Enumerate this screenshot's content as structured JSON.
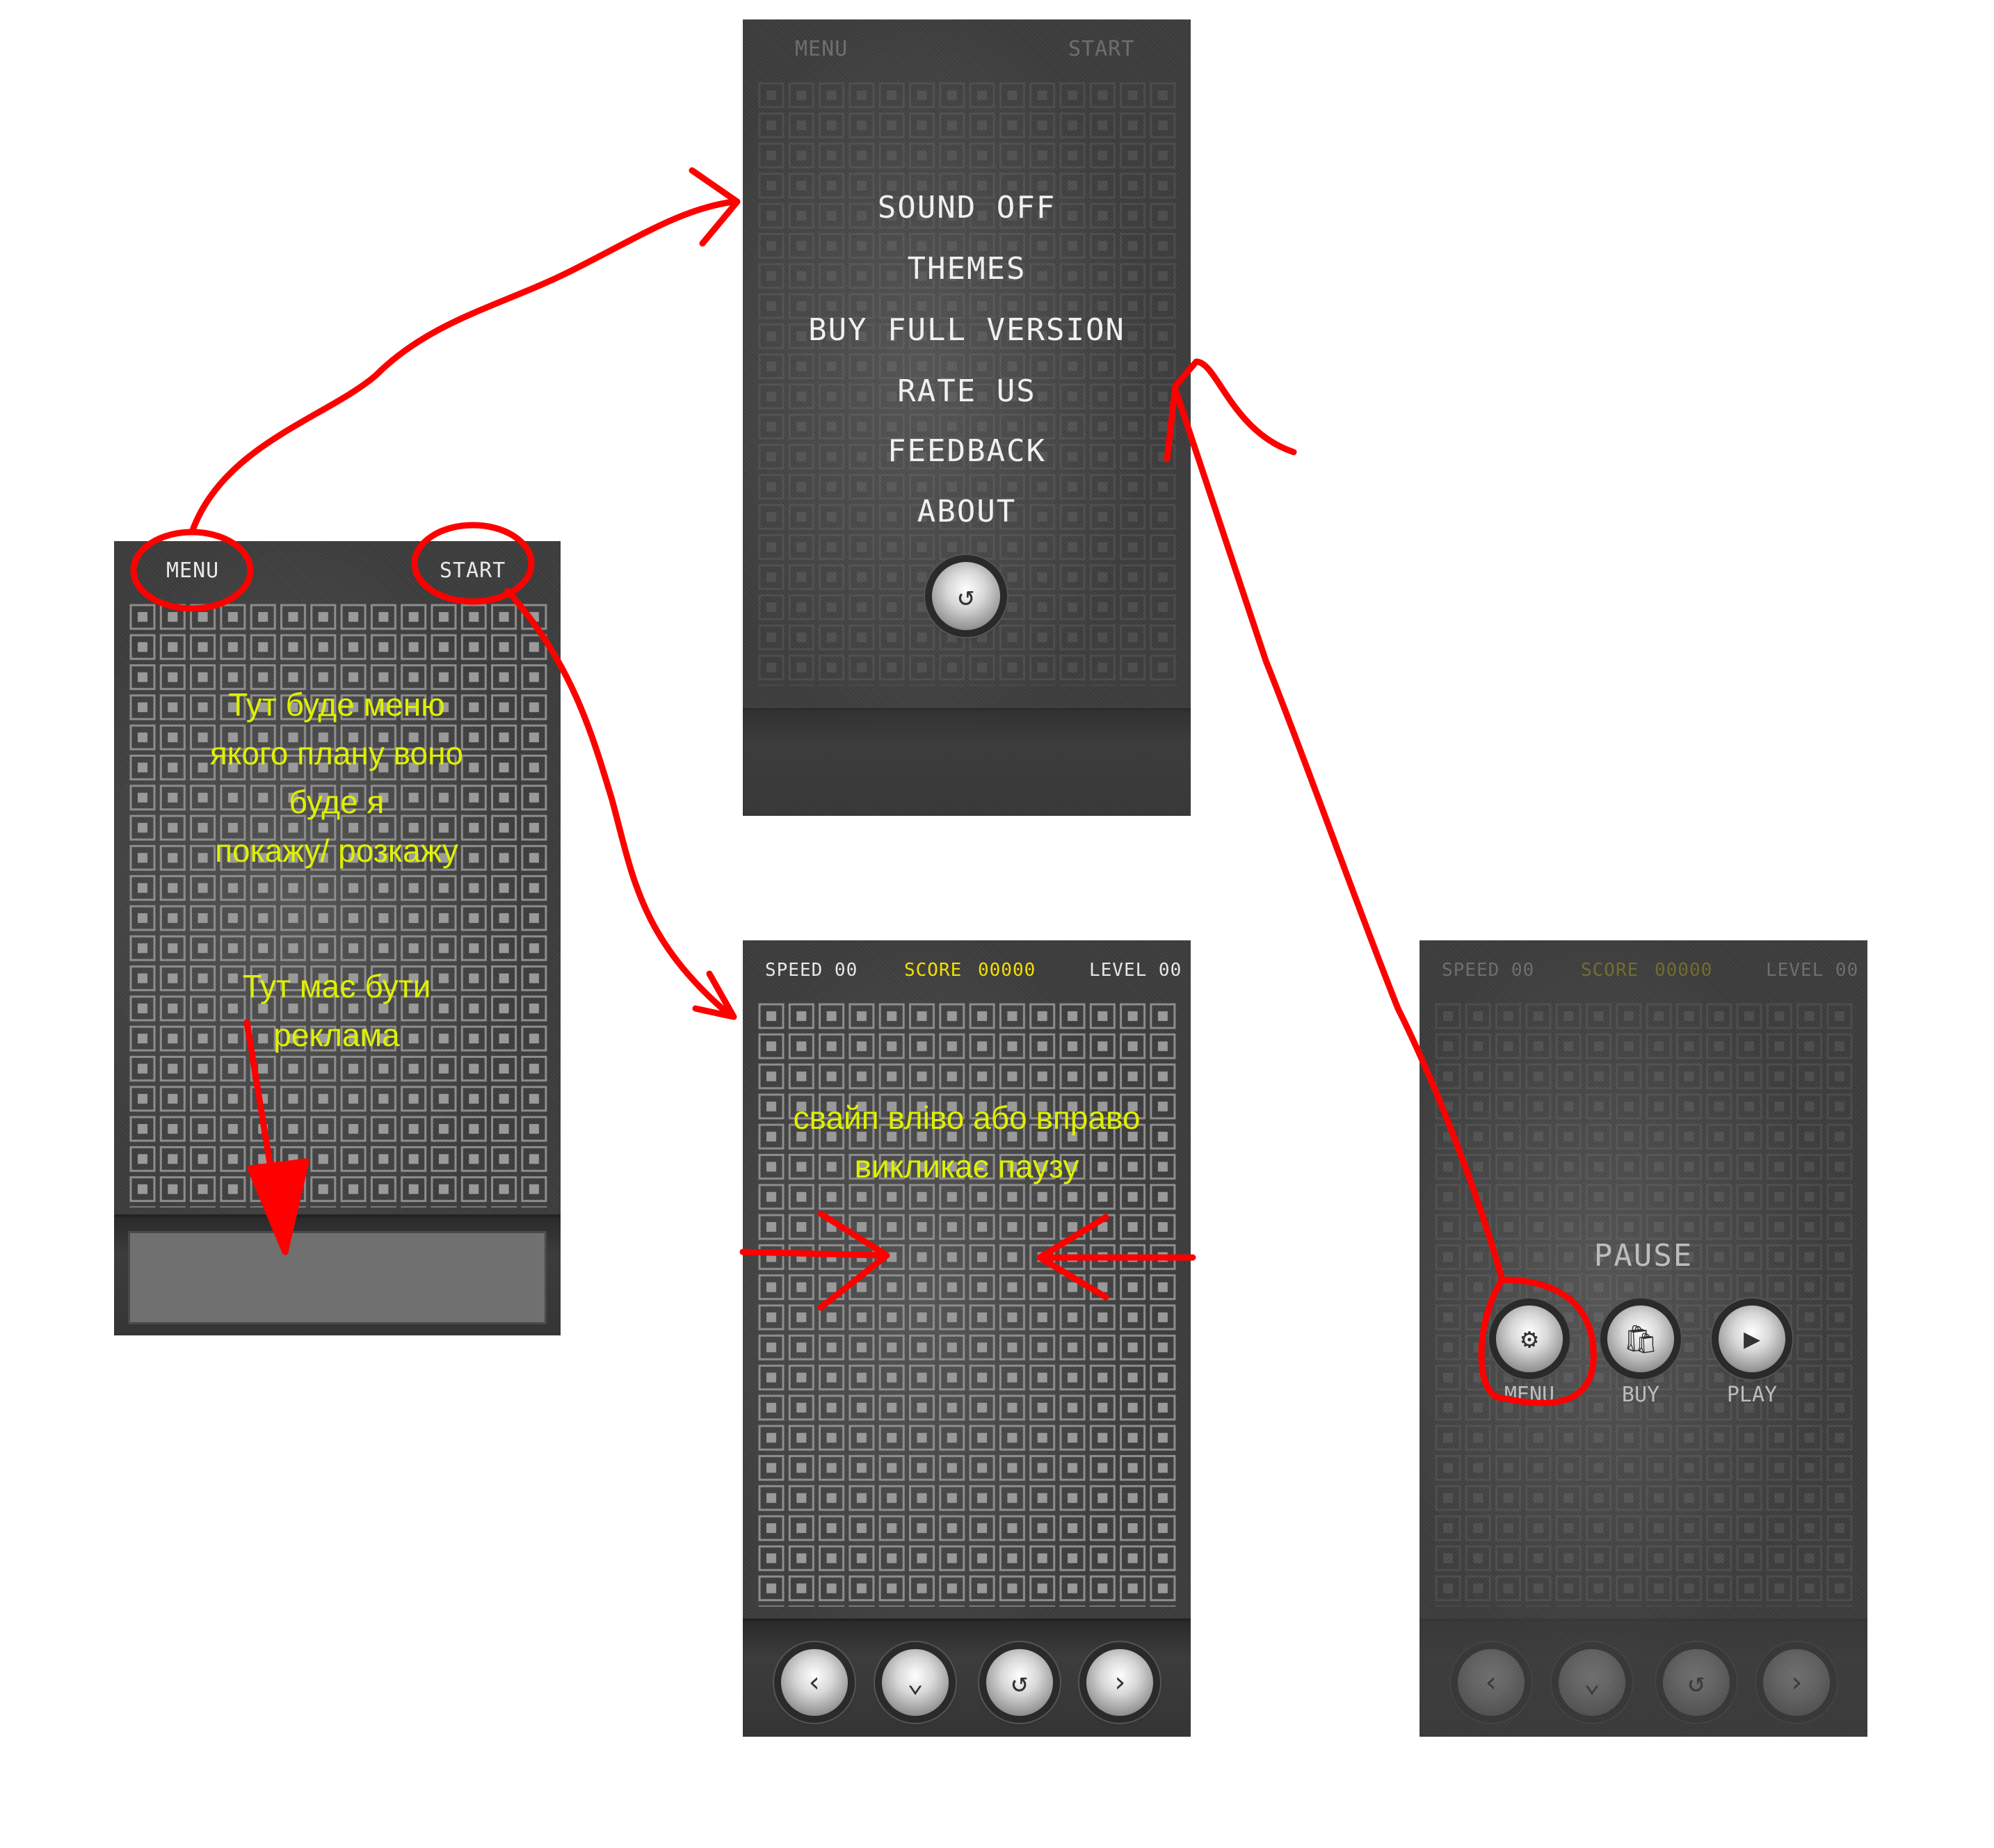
{
  "home": {
    "menu_label": "MENU",
    "start_label": "START",
    "note_menu_1": "Тут буде меню",
    "note_menu_2": "якого плану воно",
    "note_menu_3": "буде я",
    "note_menu_4": "покажу/ розкажу",
    "note_ad_1": "Тут має бути",
    "note_ad_2": "реклама"
  },
  "menu_screen": {
    "top_left": "MENU",
    "top_right": "START",
    "items": [
      "SOUND OFF",
      "THEMES",
      "BUY FULL VERSION",
      "RATE US",
      "FEEDBACK",
      "ABOUT"
    ],
    "back_icon": "undo-icon"
  },
  "game": {
    "speed_label": "SPEED 00",
    "score_label": "SCORE",
    "score_value": "00000",
    "level_label": "LEVEL 00",
    "note_1": "свайп вліво або вправо",
    "note_2": "викликає паузу",
    "controls": [
      "chevron-left-icon",
      "chevron-down-icon",
      "rotate-icon",
      "chevron-right-icon"
    ]
  },
  "pause_screen": {
    "speed_label": "SPEED 00",
    "score_label": "SCORE",
    "score_value": "00000",
    "level_label": "LEVEL 00",
    "title": "PAUSE",
    "buttons": [
      {
        "label": "MENU",
        "icon": "gear-icon"
      },
      {
        "label": "BUY",
        "icon": "shopping-bag-icon"
      },
      {
        "label": "PLAY",
        "icon": "play-icon"
      }
    ]
  },
  "colors": {
    "annotation_red": "#ff0000",
    "annotation_yellow": "#dff000",
    "score_yellow": "#f4e000",
    "screen_bg": "#3c3c3c"
  }
}
